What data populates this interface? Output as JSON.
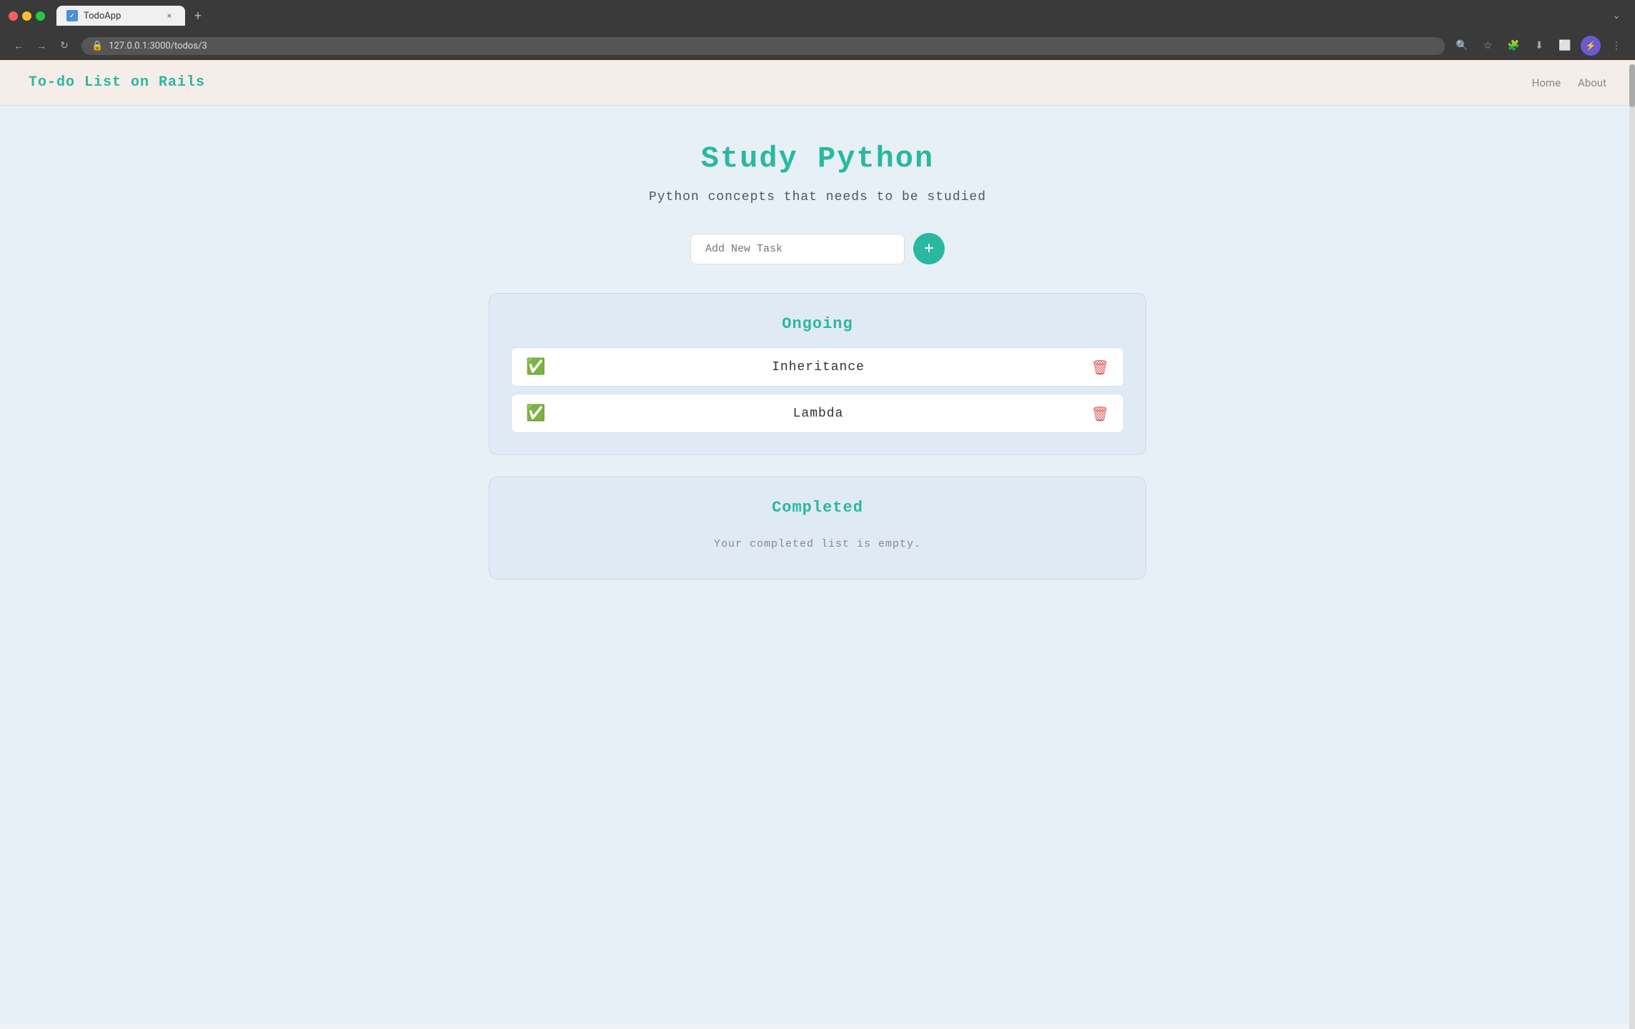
{
  "browser": {
    "tab_title": "TodoApp",
    "tab_close": "×",
    "tab_new": "+",
    "url": "127.0.0.1:3000/todos/3",
    "nav_back": "←",
    "nav_forward": "→",
    "nav_refresh": "↻"
  },
  "app": {
    "brand": "To-do List on Rails",
    "nav_links": [
      {
        "label": "Home",
        "href": "/"
      },
      {
        "label": "About",
        "href": "/about"
      }
    ],
    "page_title": "Study Python",
    "page_subtitle": "Python concepts that needs to be studied",
    "add_task_placeholder": "Add New Task",
    "add_task_btn_label": "+",
    "sections": [
      {
        "id": "ongoing",
        "title": "Ongoing",
        "tasks": [
          {
            "id": 1,
            "name": "Inheritance"
          },
          {
            "id": 2,
            "name": "Lambda"
          }
        ]
      },
      {
        "id": "completed",
        "title": "Completed",
        "empty_message": "Your completed list is empty.",
        "tasks": []
      }
    ]
  }
}
